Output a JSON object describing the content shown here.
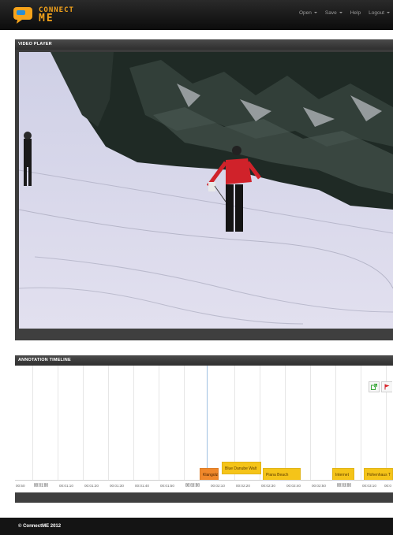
{
  "app": {
    "logo_line1": "CONNECT",
    "logo_line2": "ME"
  },
  "nav": {
    "open_label": "Open",
    "save_label": "Save",
    "help_label": "Help",
    "logout_label": "Logout"
  },
  "video_panel": {
    "title": "VIDEO PLAYER"
  },
  "timeline_panel": {
    "title": "ANNOTATION TIMELINE",
    "annotations": [
      {
        "label": "Klangolz",
        "color": "#f0882b"
      },
      {
        "label": "Blue Danube Walt",
        "color": "#f5c419"
      },
      {
        "label": "Piana Beach",
        "color": "#f5c419"
      },
      {
        "label": "Internet",
        "color": "#f5c419"
      },
      {
        "label": "Hohenhaus T",
        "color": "#f5c419"
      }
    ],
    "ticks": [
      "00:50",
      "00:01:00",
      "00:01:10",
      "00:01:20",
      "00:01:30",
      "00:01:40",
      "00:01:50",
      "00:02:00",
      "00:02:10",
      "00:02:20",
      "00:02:30",
      "00:02:40",
      "00:02:50",
      "00:03:00",
      "00:03:10",
      "00:0"
    ],
    "sub_ticks": [
      "00:01:00",
      "00:02:00",
      "00:03:00"
    ]
  },
  "footer": {
    "copyright": "© ConnectME 2012"
  },
  "colors": {
    "brand": "#f5a31b",
    "annotation_yellow": "#f5c419",
    "annotation_orange": "#f0882b"
  }
}
